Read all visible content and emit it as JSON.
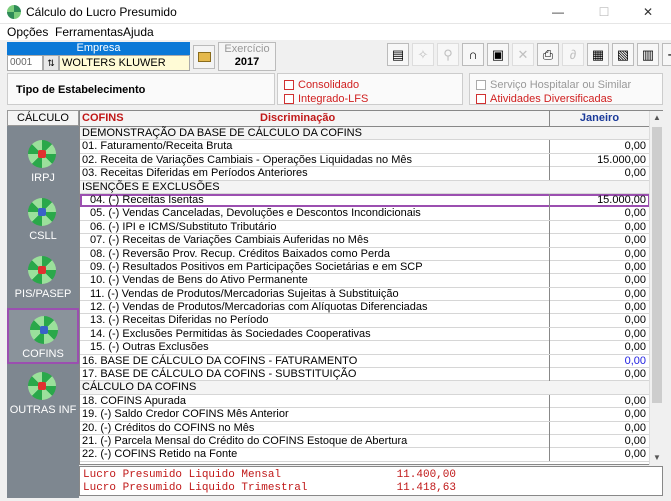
{
  "window": {
    "title": "Cálculo do Lucro Presumido",
    "minimize": "—",
    "maximize": "☐",
    "close": "✕"
  },
  "menu": [
    "Opções",
    "Ferramentas",
    "Ajuda"
  ],
  "empresa": {
    "header": "Empresa",
    "code": "0001",
    "name": "WOLTERS KLUWER"
  },
  "exercicio": {
    "label": "Exercício",
    "value": "2017"
  },
  "toolbar_icons": [
    {
      "name": "document-icon",
      "glyph": "▤",
      "disabled": false
    },
    {
      "name": "wand-icon",
      "glyph": "✧",
      "disabled": true
    },
    {
      "name": "search-icon",
      "glyph": "⚲",
      "disabled": true
    },
    {
      "name": "headset-icon",
      "glyph": "∩",
      "disabled": false
    },
    {
      "name": "save-icon",
      "glyph": "▣",
      "disabled": false
    },
    {
      "name": "delete-icon",
      "glyph": "✕",
      "disabled": true
    },
    {
      "name": "print-icon",
      "glyph": "⎙",
      "disabled": false
    },
    {
      "name": "attach-icon",
      "glyph": "∂",
      "disabled": true
    },
    {
      "name": "report-icon",
      "glyph": "▦",
      "disabled": false
    },
    {
      "name": "print-preview-icon",
      "glyph": "▧",
      "disabled": false
    },
    {
      "name": "print-setup-icon",
      "glyph": "▥",
      "disabled": false
    },
    {
      "name": "exit-icon",
      "glyph": "⇥",
      "disabled": false
    }
  ],
  "estabelecimento": {
    "label": "Tipo de Estabelecimento"
  },
  "checks": {
    "consolidado": "Consolidado",
    "integrado": "Integrado-LFS",
    "servico_hospitalar": "Serviço Hospitalar ou Similar",
    "atividades": "Atividades Diversificadas"
  },
  "nav": {
    "header": "CÁLCULO",
    "items": [
      {
        "label": "IRPJ",
        "active": false
      },
      {
        "label": "CSLL",
        "active": false
      },
      {
        "label": "PIS/PASEP",
        "active": false
      },
      {
        "label": "COFINS",
        "active": true
      },
      {
        "label": "OUTRAS INF",
        "active": false
      }
    ]
  },
  "grid": {
    "col_tributo": "COFINS",
    "col_discriminacao": "Discriminação",
    "col_mes": "Janeiro",
    "rows": [
      {
        "label": "DEMONSTRAÇÃO DA BASE DE CÁLCULO DA COFINS",
        "value": "",
        "type": "section"
      },
      {
        "label": "01. Faturamento/Receita Bruta",
        "value": "0,00",
        "type": "item",
        "white": true
      },
      {
        "label": "02. Receita de Variações Cambiais - Operações Liquidadas no Mês",
        "value": "15.000,00",
        "type": "item"
      },
      {
        "label": "03. Receitas Diferidas em Períodos Anteriores",
        "value": "0,00",
        "type": "item"
      },
      {
        "label": "ISENÇÕES E EXCLUSÕES",
        "value": "",
        "type": "section"
      },
      {
        "label": "04. (-) Receitas Isentas",
        "value": "15.000,00",
        "type": "indent",
        "selected": true
      },
      {
        "label": "05. (-) Vendas Canceladas, Devoluções e Descontos Incondicionais",
        "value": "0,00",
        "type": "indent"
      },
      {
        "label": "06. (-) IPI e ICMS/Substituto Tributário",
        "value": "0,00",
        "type": "indent"
      },
      {
        "label": "07. (-) Receitas de Variações Cambiais Auferidas no Mês",
        "value": "0,00",
        "type": "indent"
      },
      {
        "label": "08. (-) Reversão Prov. Recup. Créditos Baixados como Perda",
        "value": "0,00",
        "type": "indent"
      },
      {
        "label": "09. (-) Resultados Positivos em Participações Societárias e em SCP",
        "value": "0,00",
        "type": "indent"
      },
      {
        "label": "10. (-) Vendas de Bens do Ativo Permanente",
        "value": "0,00",
        "type": "indent"
      },
      {
        "label": "11. (-) Vendas de Produtos/Mercadorias Sujeitas à Substituição",
        "value": "0,00",
        "type": "indent"
      },
      {
        "label": "12. (-) Vendas de Produtos/Mercadorias com Alíquotas Diferenciadas",
        "value": "0,00",
        "type": "indent"
      },
      {
        "label": "13. (-) Receitas Diferidas no Período",
        "value": "0,00",
        "type": "indent"
      },
      {
        "label": "14. (-) Exclusões Permitidas às Sociedades Cooperativas",
        "value": "0,00",
        "type": "indent"
      },
      {
        "label": "15. (-) Outras Exclusões",
        "value": "0,00",
        "type": "indent"
      },
      {
        "label": "16. BASE DE CÁLCULO DA COFINS - FATURAMENTO",
        "value": "0,00",
        "type": "item",
        "blue": true
      },
      {
        "label": "17. BASE DE CÁLCULO DA COFINS - SUBSTITUIÇÃO",
        "value": "0,00",
        "type": "item"
      },
      {
        "label": "CÁLCULO DA COFINS",
        "value": "",
        "type": "section"
      },
      {
        "label": "18. COFINS Apurada",
        "value": "0,00",
        "type": "item"
      },
      {
        "label": "19. (-) Saldo Credor COFINS Mês Anterior",
        "value": "0,00",
        "type": "item"
      },
      {
        "label": "20. (-) Créditos do COFINS no Mês",
        "value": "0,00",
        "type": "item"
      },
      {
        "label": "21. (-) Parcela Mensal do Crédito do COFINS Estoque de Abertura",
        "value": "0,00",
        "type": "item"
      },
      {
        "label": "22. (-) COFINS Retido na Fonte",
        "value": "0,00",
        "type": "item"
      }
    ]
  },
  "footer": [
    {
      "label": "Lucro Presumido Liquido Mensal",
      "value": "11.400,00"
    },
    {
      "label": "Lucro Presumido Liquido Trimestral",
      "value": "11.418,63"
    }
  ]
}
